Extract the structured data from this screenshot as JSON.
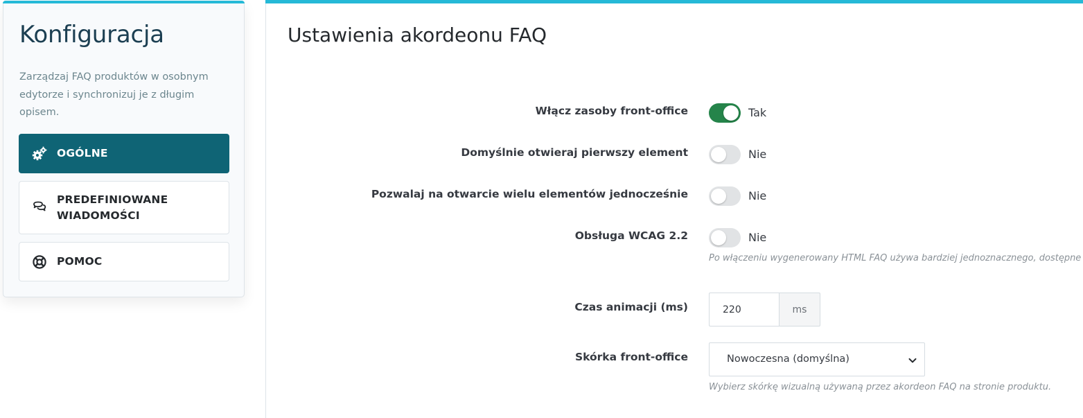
{
  "sidebar": {
    "title": "Konfiguracja",
    "description": "Zarządzaj FAQ produktów w osobnym edytorze i synchronizuj je z długim opisem.",
    "items": [
      {
        "label": "OGÓLNE",
        "icon": "gears-icon",
        "active": true
      },
      {
        "label": "PREDEFINIOWANE WIADOMOŚCI",
        "icon": "chat-bubbles-icon",
        "active": false
      },
      {
        "label": "POMOC",
        "icon": "lifebuoy-icon",
        "active": false
      }
    ]
  },
  "main": {
    "title": "Ustawienia akordeonu FAQ",
    "fields": {
      "front_assets": {
        "label": "Włącz zasoby front-office",
        "value": true,
        "state_text": "Tak"
      },
      "open_first": {
        "label": "Domyślnie otwieraj pierwszy element",
        "value": false,
        "state_text": "Nie"
      },
      "multi_open": {
        "label": "Pozwalaj na otwarcie wielu elementów jednocześnie",
        "value": false,
        "state_text": "Nie"
      },
      "wcag": {
        "label": "Obsługa WCAG 2.2",
        "value": false,
        "state_text": "Nie",
        "help": "Po włączeniu wygenerowany HTML FAQ używa bardziej jednoznacznego, dostępne"
      },
      "animation": {
        "label": "Czas animacji (ms)",
        "value": "220",
        "unit": "ms"
      },
      "skin": {
        "label": "Skórka front-office",
        "selected": "Nowoczesna (domyślna)",
        "help": "Wybierz skórkę wizualną używaną przez akordeon FAQ na stronie produktu."
      }
    }
  },
  "colors": {
    "accent": "#25b9d7",
    "active_nav": "#0f6475",
    "switch_on": "#25844a",
    "switch_off": "#e1e3e5"
  }
}
